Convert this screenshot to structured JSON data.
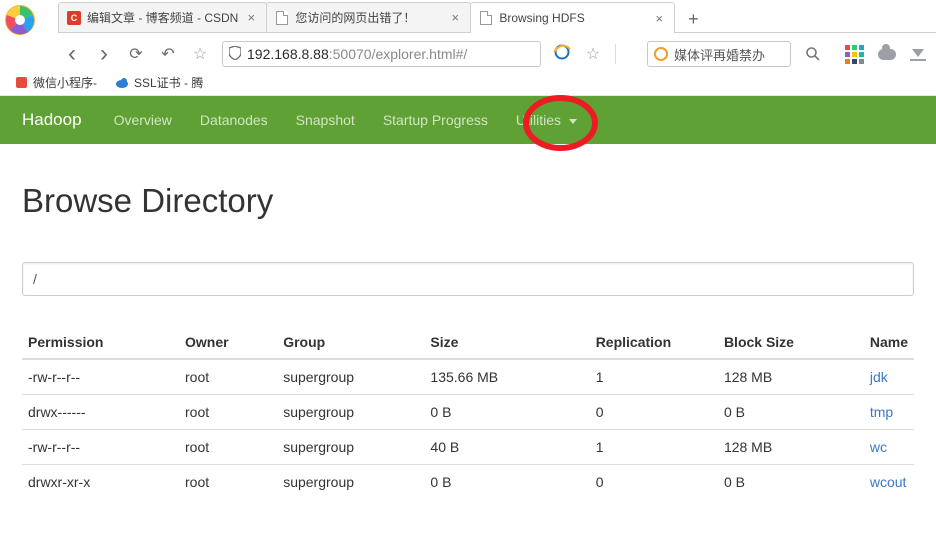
{
  "browser": {
    "tabs": [
      {
        "title": "编辑文章 - 博客频道 - CSDN",
        "icon": "csdn",
        "active": false
      },
      {
        "title": "您访问的网页出错了！",
        "icon": "file",
        "active": false
      },
      {
        "title": "Browsing HDFS",
        "icon": "file",
        "active": true
      }
    ],
    "new_tab": "+",
    "close_glyph": "×",
    "back": "‹",
    "forward": "›",
    "reload": "⟳",
    "undo": "↶",
    "star": "☆",
    "shield": "🛡",
    "address_host": "192.168.8.88",
    "address_rest": ":50070/explorer.html#/",
    "star2": "☆",
    "search_text": "媒体评再婚禁办",
    "search_icon_glyph": "search"
  },
  "bookmarks": [
    {
      "label": "微信小程序-",
      "icon_color": "#e64b3b",
      "icon": "generic"
    },
    {
      "label": "SSL证书 - 腾",
      "icon_color": "#2f7fd1",
      "icon": "cloud"
    }
  ],
  "hadoop_nav": {
    "brand": "Hadoop",
    "items": [
      "Overview",
      "Datanodes",
      "Snapshot",
      "Startup Progress"
    ],
    "dropdown": "Utilities"
  },
  "page": {
    "title": "Browse Directory",
    "path_value": "/",
    "columns": [
      "Permission",
      "Owner",
      "Group",
      "Size",
      "Replication",
      "Block Size",
      "Name"
    ],
    "rows": [
      {
        "perm": "-rw-r--r--",
        "owner": "root",
        "group": "supergroup",
        "size": "135.66 MB",
        "rep": "1",
        "bs": "128 MB",
        "name": "jdk"
      },
      {
        "perm": "drwx------",
        "owner": "root",
        "group": "supergroup",
        "size": "0 B",
        "rep": "0",
        "bs": "0 B",
        "name": "tmp"
      },
      {
        "perm": "-rw-r--r--",
        "owner": "root",
        "group": "supergroup",
        "size": "40 B",
        "rep": "1",
        "bs": "128 MB",
        "name": "wc"
      },
      {
        "perm": "drwxr-xr-x",
        "owner": "root",
        "group": "supergroup",
        "size": "0 B",
        "rep": "0",
        "bs": "0 B",
        "name": "wcout"
      }
    ]
  }
}
